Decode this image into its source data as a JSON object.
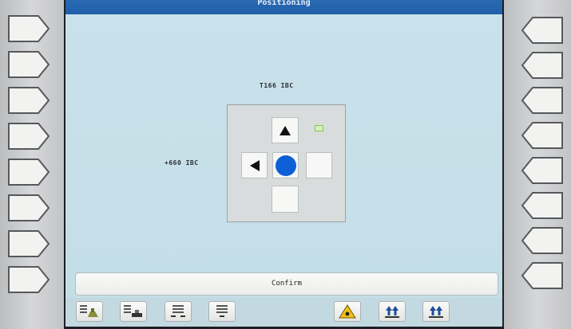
{
  "screen": {
    "title": "Positioning"
  },
  "position": {
    "y_label": "T166 IBC",
    "x_label": "+660 IBC"
  },
  "confirm": {
    "label": "Confirm"
  },
  "colors": {
    "title_bar": "#2463ab",
    "screen_bg": "#c6dfe8",
    "center_dot": "#0d5fd6",
    "indicator": "#8fc83a"
  },
  "softkeys": {
    "left_count": 8,
    "right_count": 8
  },
  "toolbar": {
    "icons": [
      "stack-machine-icon",
      "stack-table-icon",
      "grid-range-icon",
      "grid-single-icon",
      "warning-icon",
      "raise-icon",
      "lower-icon"
    ]
  }
}
